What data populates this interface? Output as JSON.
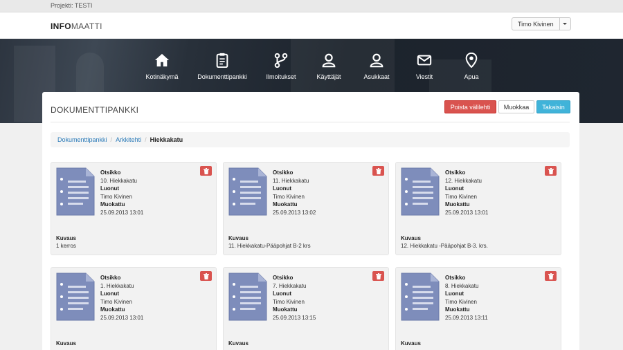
{
  "project_bar": {
    "text": "Projekti: TESTI"
  },
  "header": {
    "logo_bold": "INFO",
    "logo_light": "MAATTI",
    "user_name": "Timo Kivinen"
  },
  "nav": {
    "items": [
      {
        "label": "Kotinäkymä",
        "icon": "home-icon"
      },
      {
        "label": "Dokumenttipankki",
        "icon": "clipboard-icon"
      },
      {
        "label": "Ilmoitukset",
        "icon": "branch-icon"
      },
      {
        "label": "Käyttäjät",
        "icon": "users-icon"
      },
      {
        "label": "Asukkaat",
        "icon": "residents-icon"
      },
      {
        "label": "Viestit",
        "icon": "envelope-icon"
      },
      {
        "label": "Apua",
        "icon": "map-pin-icon"
      }
    ]
  },
  "panel": {
    "title": "DOKUMENTTIPANKKI",
    "buttons": {
      "delete_tab": "Poista välilehti",
      "edit": "Muokkaa",
      "back": "Takaisin"
    },
    "colors": {
      "danger": "#d9534f",
      "info": "#40b3d9",
      "link": "#2a7ab8"
    }
  },
  "breadcrumb": {
    "items": [
      "Dokumenttipankki",
      "Arkkitehti"
    ],
    "active": "Hiekkakatu"
  },
  "field_labels": {
    "title": "Otsikko",
    "created_by": "Luonut",
    "modified": "Muokattu",
    "description": "Kuvaus"
  },
  "documents": [
    {
      "title": "10. Hiekkakatu",
      "creator": "Timo Kivinen",
      "modified": "25.09.2013 13:01",
      "description": "1 kerros"
    },
    {
      "title": "11. Hiekkakatu",
      "creator": "Timo Kivinen",
      "modified": "25.09.2013 13:02",
      "description": "11. Hiekkakatu-Pääpohjat B-2 krs"
    },
    {
      "title": "12. Hiekkakatu",
      "creator": "Timo Kivinen",
      "modified": "25.09.2013 13:01",
      "description": "12. Hiekkakatu -Pääpohjat B-3. krs."
    },
    {
      "title": "1. Hiekkakatu",
      "creator": "Timo Kivinen",
      "modified": "25.09.2013 13:01",
      "description": ""
    },
    {
      "title": "7. Hiekkakatu",
      "creator": "Timo Kivinen",
      "modified": "25.09.2013 13:15",
      "description": ""
    },
    {
      "title": "8. Hiekkakatu",
      "creator": "Timo Kivinen",
      "modified": "25.09.2013 13:11",
      "description": ""
    }
  ]
}
